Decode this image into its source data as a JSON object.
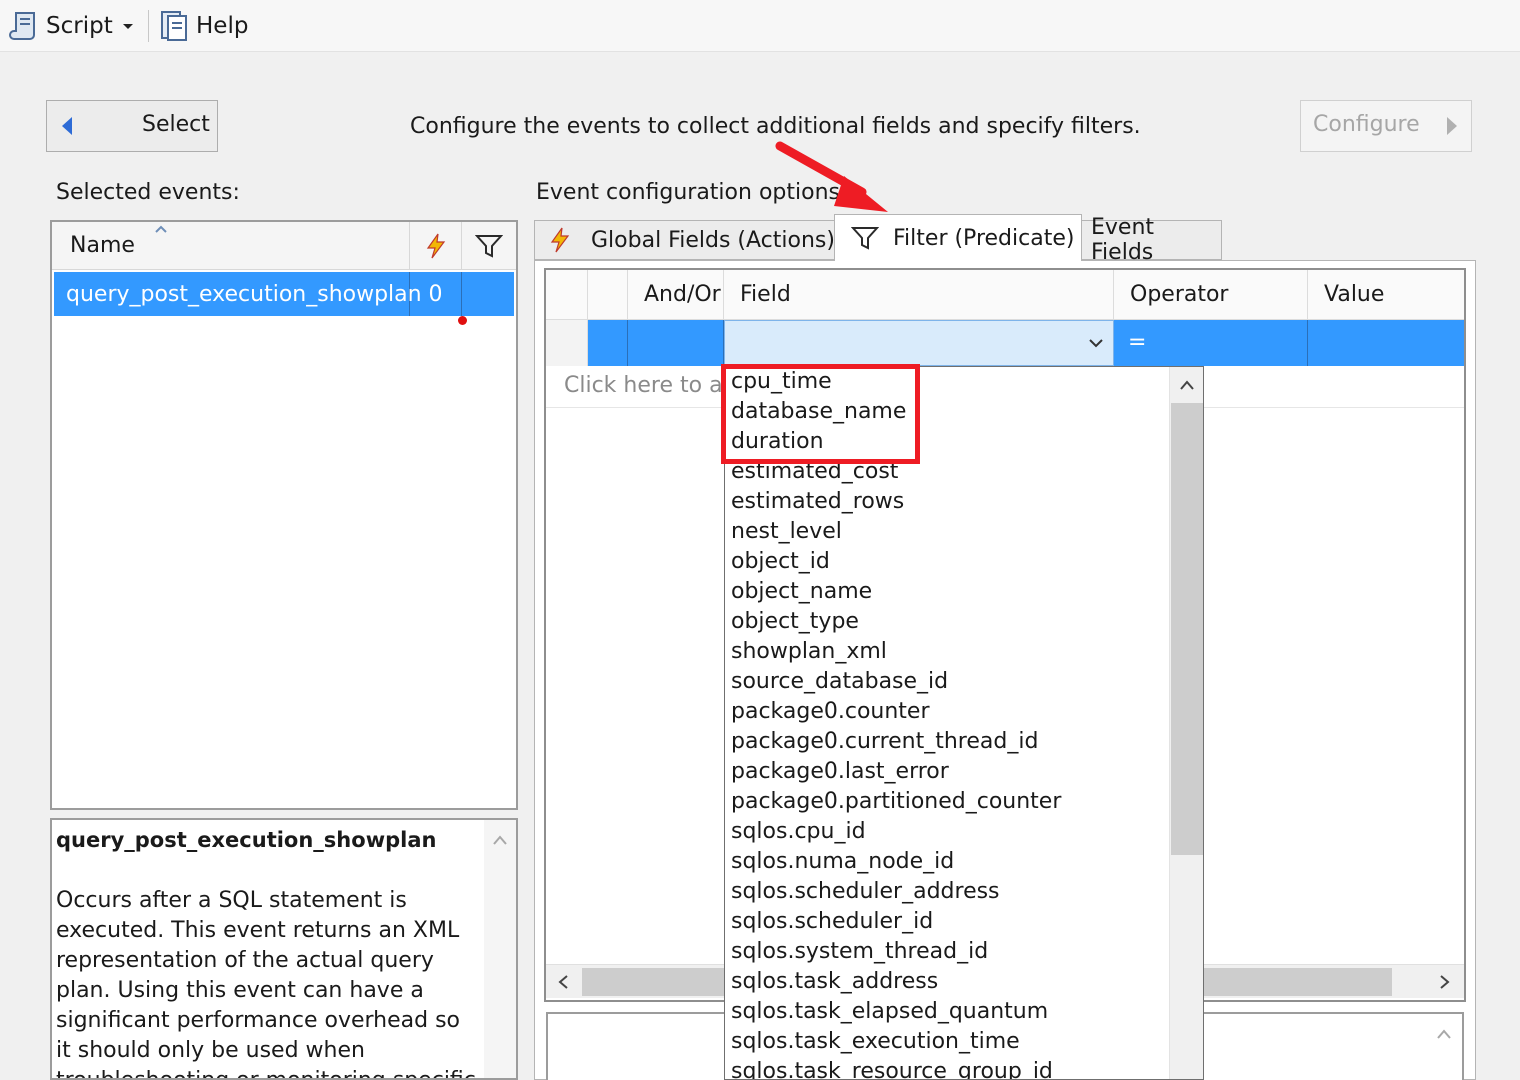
{
  "toolbar": {
    "script_label": "Script",
    "help_label": "Help"
  },
  "wizard": {
    "back_label": "Select",
    "instruction": "Configure the events to collect additional fields and specify filters.",
    "next_label": "Configure"
  },
  "events": {
    "section_label": "Selected events:",
    "columns": {
      "name": "Name"
    },
    "rows": [
      {
        "name": "query_post_execution_showplan",
        "actions": "0"
      }
    ]
  },
  "description": {
    "title": "query_post_execution_showplan",
    "body": "Occurs after a SQL statement is executed. This event returns an XML representation of the actual query plan. Using this event can have a significant performance overhead so it should only be used when troubleshooting or monitoring specific problems for brief"
  },
  "config": {
    "section_label": "Event configuration options:",
    "tabs": [
      {
        "label": "Global Fields (Actions)"
      },
      {
        "label": "Filter (Predicate)"
      },
      {
        "label": "Event Fields"
      }
    ]
  },
  "filter_grid": {
    "columns": {
      "and_or": "And/Or",
      "field": "Field",
      "operator": "Operator",
      "value": "Value"
    },
    "row": {
      "field": "",
      "operator": "=",
      "value": ""
    },
    "add_hint": "Click here to add a clause"
  },
  "field_options": [
    "cpu_time",
    "database_name",
    "duration",
    "estimated_cost",
    "estimated_rows",
    "nest_level",
    "object_id",
    "object_name",
    "object_type",
    "showplan_xml",
    "source_database_id",
    "package0.counter",
    "package0.current_thread_id",
    "package0.last_error",
    "package0.partitioned_counter",
    "sqlos.cpu_id",
    "sqlos.numa_node_id",
    "sqlos.scheduler_address",
    "sqlos.scheduler_id",
    "sqlos.system_thread_id",
    "sqlos.task_address",
    "sqlos.task_elapsed_quantum",
    "sqlos.task_execution_time",
    "sqlos.task_resource_group_id"
  ],
  "colors": {
    "selection": "#3399ff",
    "highlight": "#ee1c24",
    "actions_bolt": "#e8a000"
  }
}
